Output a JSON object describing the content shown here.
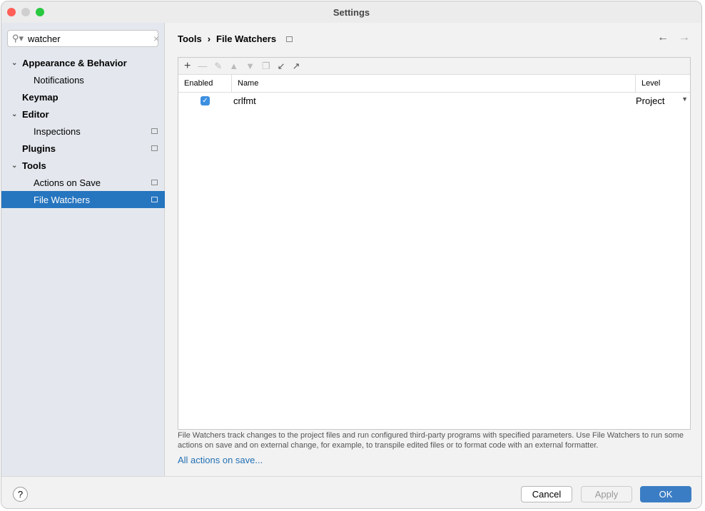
{
  "window": {
    "title": "Settings"
  },
  "search": {
    "value": "watcher"
  },
  "tree": [
    {
      "label": "Appearance & Behavior",
      "level": 0,
      "expanded": true
    },
    {
      "label": "Notifications",
      "level": 1
    },
    {
      "label": "Keymap",
      "level": 0
    },
    {
      "label": "Editor",
      "level": 0,
      "expanded": true
    },
    {
      "label": "Inspections",
      "level": 1,
      "project": true
    },
    {
      "label": "Plugins",
      "level": 0,
      "project": true
    },
    {
      "label": "Tools",
      "level": 0,
      "expanded": true
    },
    {
      "label": "Actions on Save",
      "level": 1,
      "project": true
    },
    {
      "label": "File Watchers",
      "level": 1,
      "project": true,
      "selected": true
    }
  ],
  "breadcrumb": {
    "parent": "Tools",
    "current": "File Watchers"
  },
  "table": {
    "headers": {
      "enabled": "Enabled",
      "name": "Name",
      "level": "Level"
    },
    "rows": [
      {
        "enabled": true,
        "name": "crlfmt",
        "level": "Project"
      }
    ]
  },
  "description": "File Watchers track changes to the project files and run configured third-party programs with specified parameters. Use File Watchers to run some actions on save and on external change, for example, to transpile edited files or to format code with an external formatter.",
  "link": "All actions on save...",
  "buttons": {
    "help": "?",
    "cancel": "Cancel",
    "apply": "Apply",
    "ok": "OK"
  },
  "colors": {
    "accent": "#2675bf",
    "ok": "#3b7dc4"
  }
}
